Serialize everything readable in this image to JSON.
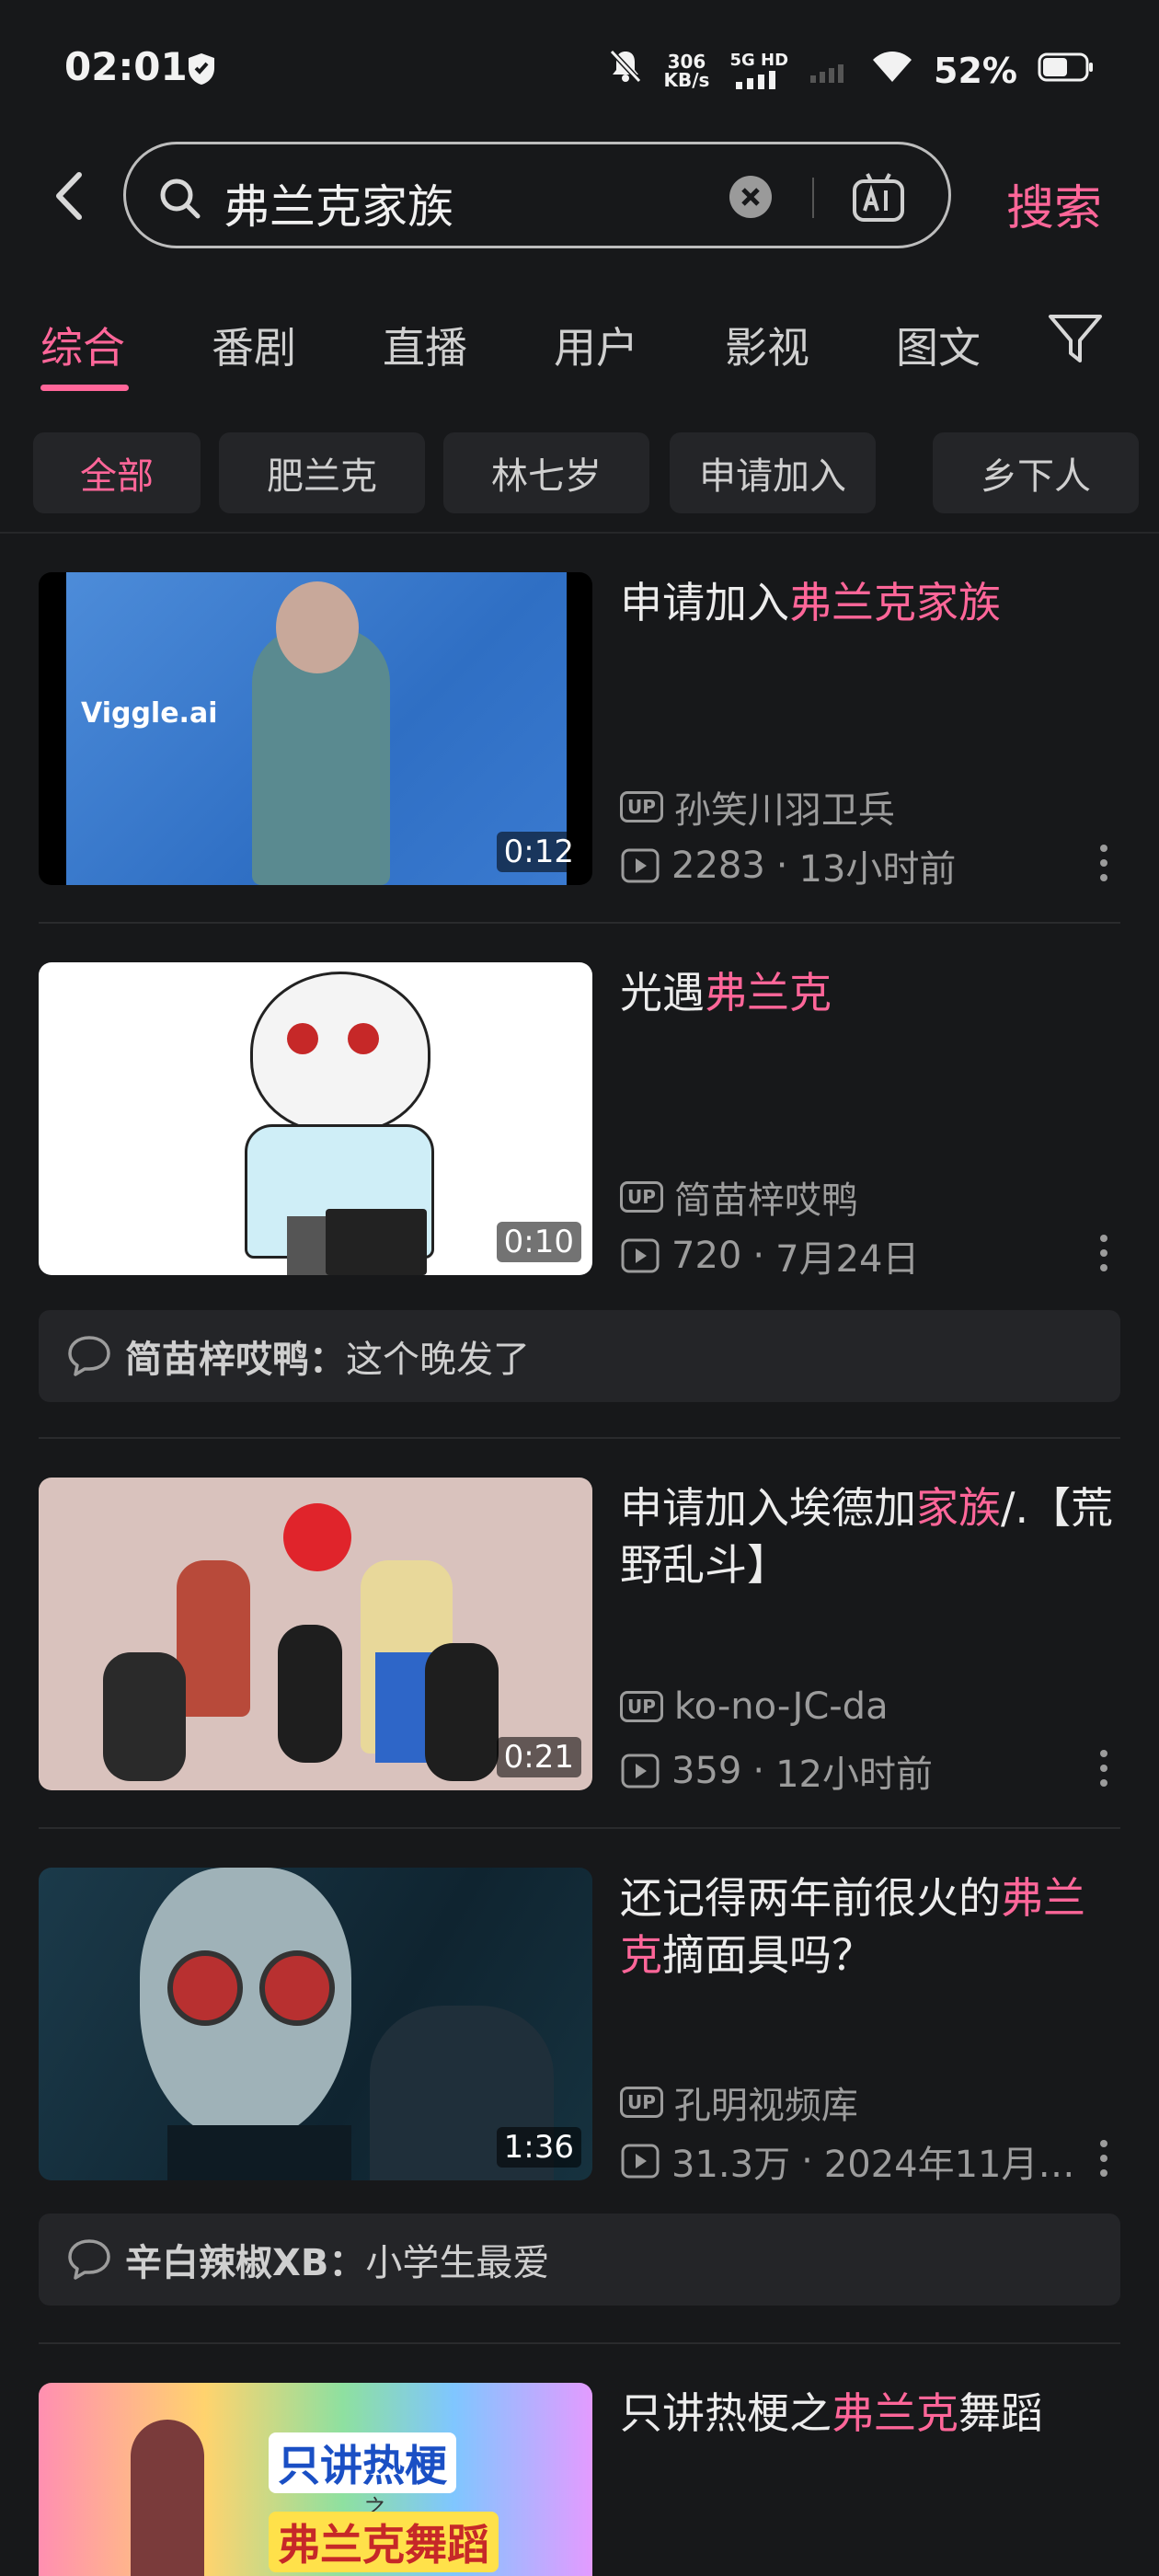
{
  "status": {
    "time": "02:01",
    "net_speed": "306",
    "net_unit": "KB/s",
    "signal": "5G HD",
    "battery": "52%"
  },
  "search": {
    "query": "弗兰克家族",
    "button": "搜索"
  },
  "tabs": [
    "综合",
    "番剧",
    "直播",
    "用户",
    "影视",
    "图文"
  ],
  "chips": [
    "全部",
    "肥兰克",
    "林七岁",
    "申请加入",
    "乡下人"
  ],
  "results": [
    {
      "title_pre": "申请加入",
      "title_hl": "弗兰克家族",
      "title_post": "",
      "uploader": "孙笑川羽卫兵",
      "views": "2283",
      "time": "13小时前",
      "duration": "0:12",
      "thumb_text": "Viggle.ai"
    },
    {
      "title_pre": "光遇",
      "title_hl": "弗兰克",
      "title_post": "",
      "uploader": "简苗梓哎鸭",
      "views": "720",
      "time": "7月24日",
      "duration": "0:10",
      "comment_user": "简苗梓哎鸭：",
      "comment_text": "这个晚发了"
    },
    {
      "title_pre": "申请加入埃德加",
      "title_hl": "家族",
      "title_post": "/.【荒野乱斗】",
      "uploader": "ko-no-JC-da",
      "views": "359",
      "time": "12小时前",
      "duration": "0:21"
    },
    {
      "title_pre": "还记得两年前很火的",
      "title_hl": "弗兰克",
      "title_post": "摘面具吗？",
      "uploader": "孔明视频库",
      "views": "31.3万",
      "time": "2024年11月…",
      "duration": "1:36",
      "comment_user": "辛白辣椒XB：",
      "comment_text": "小学生最爱"
    },
    {
      "title_pre": "只讲热梗之",
      "title_hl": "弗兰克",
      "title_post": "舞蹈",
      "thumb_line1": "只讲热梗",
      "thumb_line2": "之",
      "thumb_line3": "弗兰克舞蹈"
    }
  ],
  "colors": {
    "accent": "#ff6699",
    "background": "#17181a",
    "chip": "#242528"
  }
}
